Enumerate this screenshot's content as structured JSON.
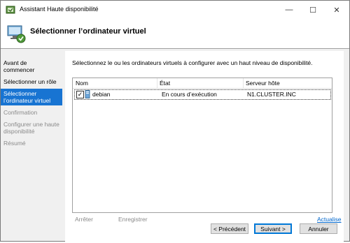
{
  "window": {
    "title": "Assistant Haute disponibilité",
    "minimize": "—",
    "maximize": "☐",
    "close": "✕"
  },
  "header": {
    "title": "Sélectionner l’ordinateur virtuel"
  },
  "nav": {
    "items": [
      {
        "label": "Avant de commencer",
        "state": "done"
      },
      {
        "label": "Sélectionner un rôle",
        "state": "done"
      },
      {
        "label": "Sélectionner l’ordinateur virtuel",
        "state": "active"
      },
      {
        "label": "Confirmation",
        "state": "disabled"
      },
      {
        "label": "Configurer une haute disponibilité",
        "state": "disabled"
      },
      {
        "label": "Résumé",
        "state": "disabled"
      }
    ]
  },
  "content": {
    "intro": "Sélectionnez le ou les ordinateurs virtuels à configurer avec un haut niveau de disponibilité.",
    "columns": {
      "name": "Nom",
      "state": "État",
      "host": "Serveur hôte"
    },
    "rows": [
      {
        "checked": "✓",
        "name": "debian",
        "state": "En cours d’exécution",
        "host": "N1.CLUSTER.INC"
      }
    ],
    "stop_label": "Arrêter",
    "save_label": "Enregistrer",
    "refresh_label": "Actualise"
  },
  "footer": {
    "previous": "< Précédent",
    "next": "Suivant >",
    "cancel": "Annuler"
  },
  "colors": {
    "accent": "#1874d2",
    "link": "#0066cc"
  }
}
